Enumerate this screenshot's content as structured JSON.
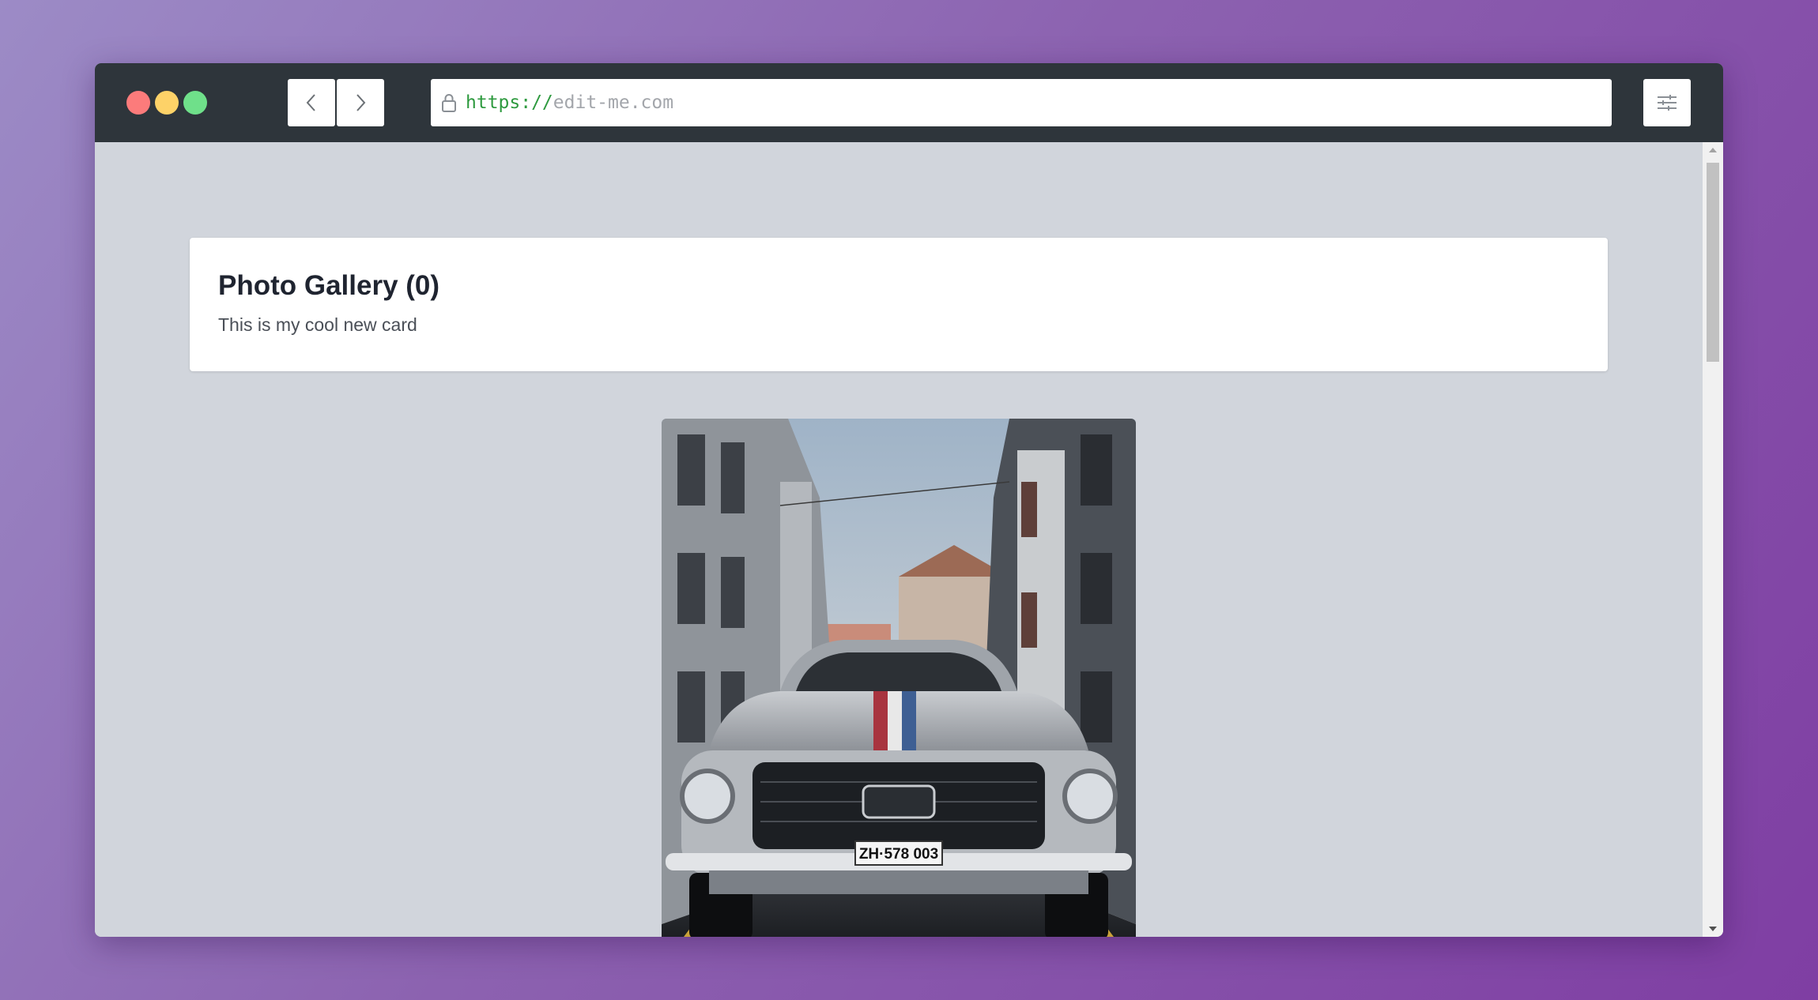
{
  "browser": {
    "url_protocol": "https://",
    "url_host": "edit-me.com",
    "icons": {
      "back": "chevron-left-icon",
      "forward": "chevron-right-icon",
      "lock": "lock-icon",
      "settings": "sliders-icon"
    },
    "traffic_lights": [
      "#fc7b7b",
      "#fdd268",
      "#6fe08a"
    ]
  },
  "card": {
    "title": "Photo Gallery (0)",
    "text": "This is my cool new card"
  },
  "gallery": {
    "photo": {
      "plate": "ZH·578 003"
    }
  }
}
